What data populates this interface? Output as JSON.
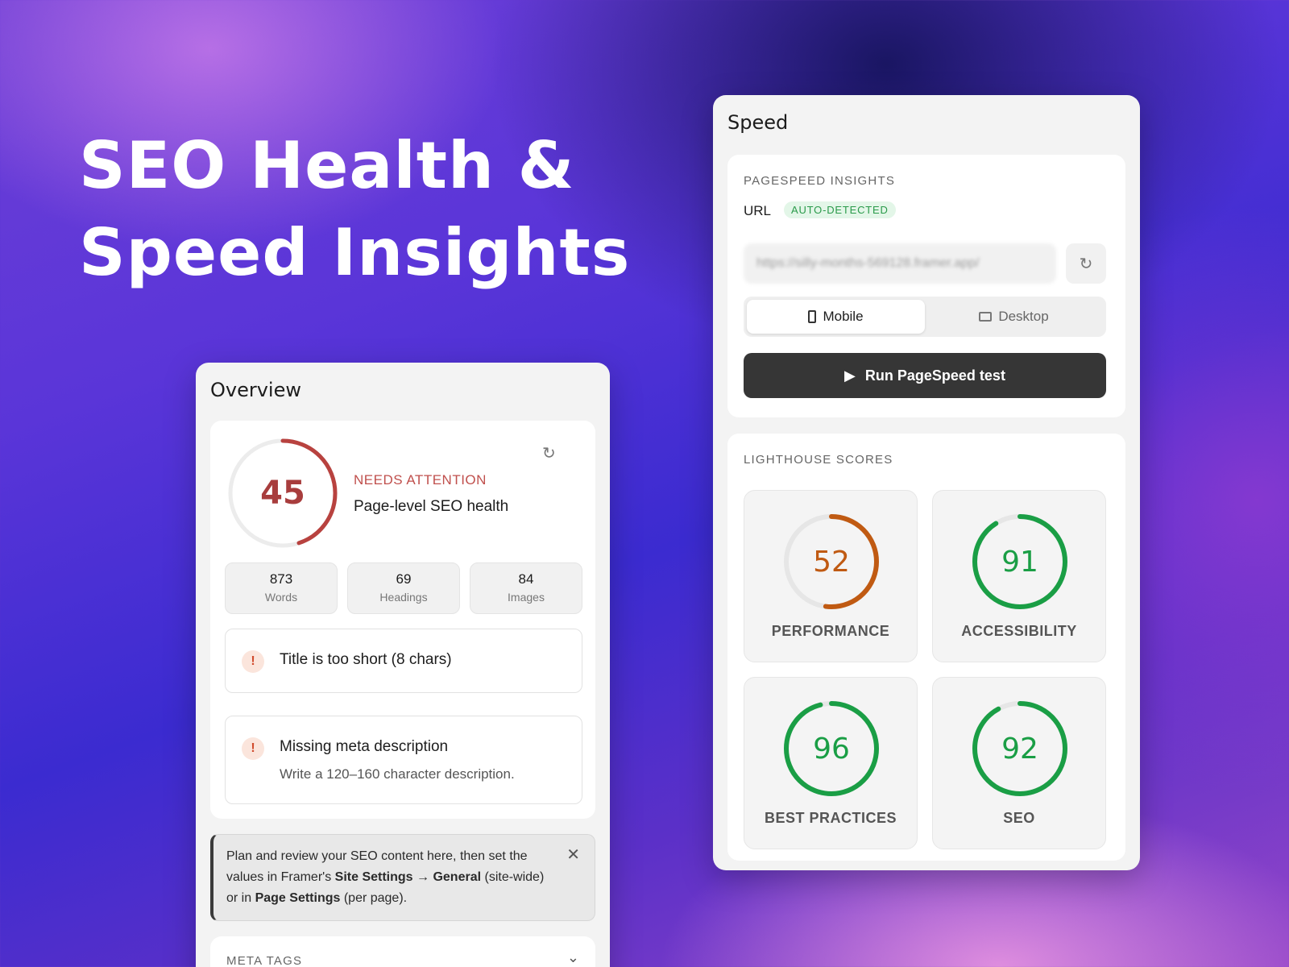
{
  "hero": {
    "line1": "SEO Health &",
    "line2": "Speed Insights"
  },
  "overview": {
    "title": "Overview",
    "score": "45",
    "score_fraction": 0.45,
    "score_color": "#b8423f",
    "status": "NEEDS ATTENTION",
    "health_label": "Page-level SEO health",
    "stats": [
      {
        "value": "873",
        "label": "Words"
      },
      {
        "value": "69",
        "label": "Headings"
      },
      {
        "value": "84",
        "label": "Images"
      }
    ],
    "issues": [
      {
        "title": "Title is too short (8 chars)",
        "desc": ""
      },
      {
        "title": "Missing meta description",
        "desc": "Write a 120–160 character description."
      }
    ],
    "note": {
      "part1": "Plan and review your SEO content here, then set the values in Framer's ",
      "bold1": "Site Settings → General",
      "part2": " (site-wide) or in ",
      "bold2": "Page Settings",
      "part3": " (per page)."
    },
    "meta_tags_label": "META TAGS"
  },
  "speed": {
    "title": "Speed",
    "pagespeed_label": "PAGESPEED INSIGHTS",
    "url_label": "URL",
    "auto_badge": "AUTO-DETECTED",
    "url_value": "https://silly-months-569128.framer.app/",
    "modes": {
      "mobile": "Mobile",
      "desktop": "Desktop",
      "selected": "mobile"
    },
    "run_label": "Run PageSpeed test",
    "lighthouse_label": "LIGHTHOUSE SCORES",
    "scores": [
      {
        "label": "PERFORMANCE",
        "value": "52",
        "color": "#c05a12"
      },
      {
        "label": "ACCESSIBILITY",
        "value": "91",
        "color": "#1a9e45"
      },
      {
        "label": "BEST PRACTICES",
        "value": "96",
        "color": "#1a9e45"
      },
      {
        "label": "SEO",
        "value": "92",
        "color": "#1a9e45"
      }
    ]
  },
  "colors": {
    "warn_icon_bg": "#fbe5dc",
    "warn_icon_fg": "#d04a2c",
    "run_button": "#363636"
  }
}
